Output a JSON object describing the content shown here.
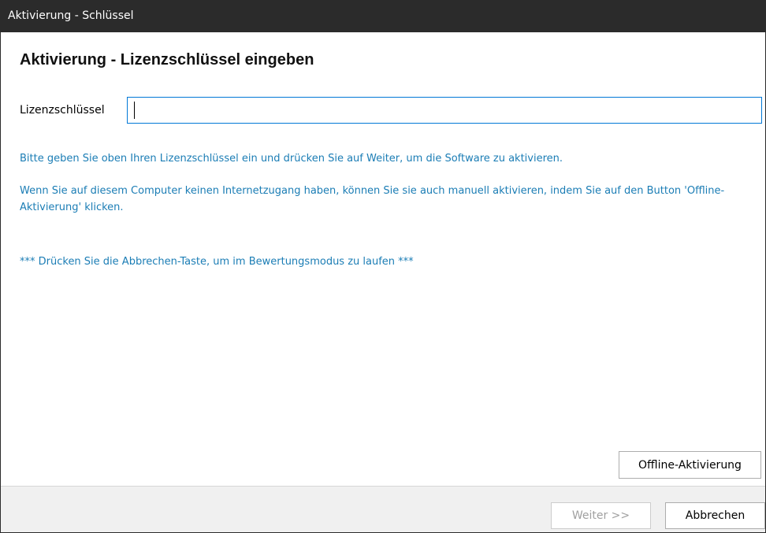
{
  "window": {
    "title": "Aktivierung - Schlüssel"
  },
  "main": {
    "heading": "Aktivierung - Lizenzschlüssel eingeben",
    "license_key": {
      "label": "Lizenzschlüssel",
      "value": "",
      "placeholder": ""
    },
    "info_lines": [
      "Bitte geben Sie oben Ihren Lizenzschlüssel ein und drücken Sie auf Weiter, um die Software zu aktivieren.",
      "Wenn Sie auf diesem Computer keinen Internetzugang haben, können Sie sie auch manuell aktivieren, indem Sie auf den Button 'Offline-Aktivierung' klicken.",
      "*** Drücken Sie die Abbrechen-Taste, um im Bewertungsmodus zu laufen ***"
    ],
    "offline_button_label": "Offline-Aktivierung"
  },
  "footer": {
    "next_label": "Weiter >>",
    "next_enabled": false,
    "cancel_label": "Abbrechen"
  },
  "colors": {
    "titlebar_bg": "#2b2b2b",
    "info_text": "#1b7db5",
    "input_focus_border": "#0078d7",
    "footer_bg": "#f0f0f0"
  }
}
